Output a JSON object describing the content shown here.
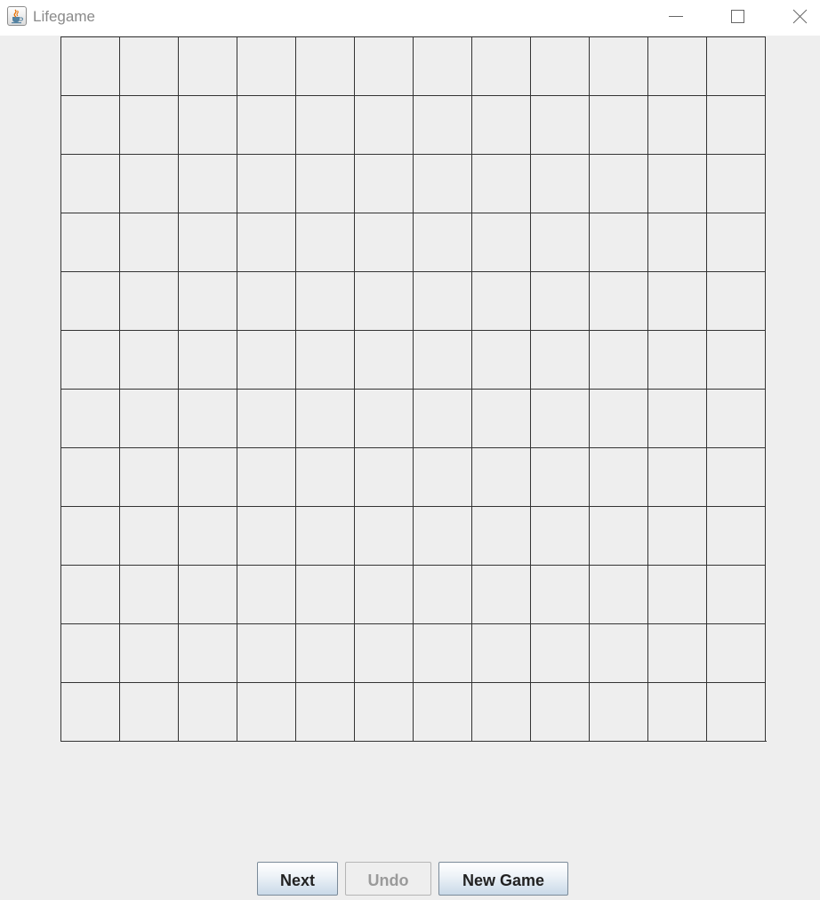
{
  "window": {
    "title": "Lifegame",
    "icon": "java-cup-icon",
    "controls": [
      "minimize-icon",
      "maximize-icon",
      "close-icon"
    ]
  },
  "board": {
    "rows": 12,
    "columns": 12,
    "alive_cells": [],
    "line_color": "#333333",
    "background_color": "#eeeeee"
  },
  "buttons": {
    "next": {
      "label": "Next",
      "enabled": true
    },
    "undo": {
      "label": "Undo",
      "enabled": false
    },
    "new_game": {
      "label": "New Game",
      "enabled": true
    }
  }
}
